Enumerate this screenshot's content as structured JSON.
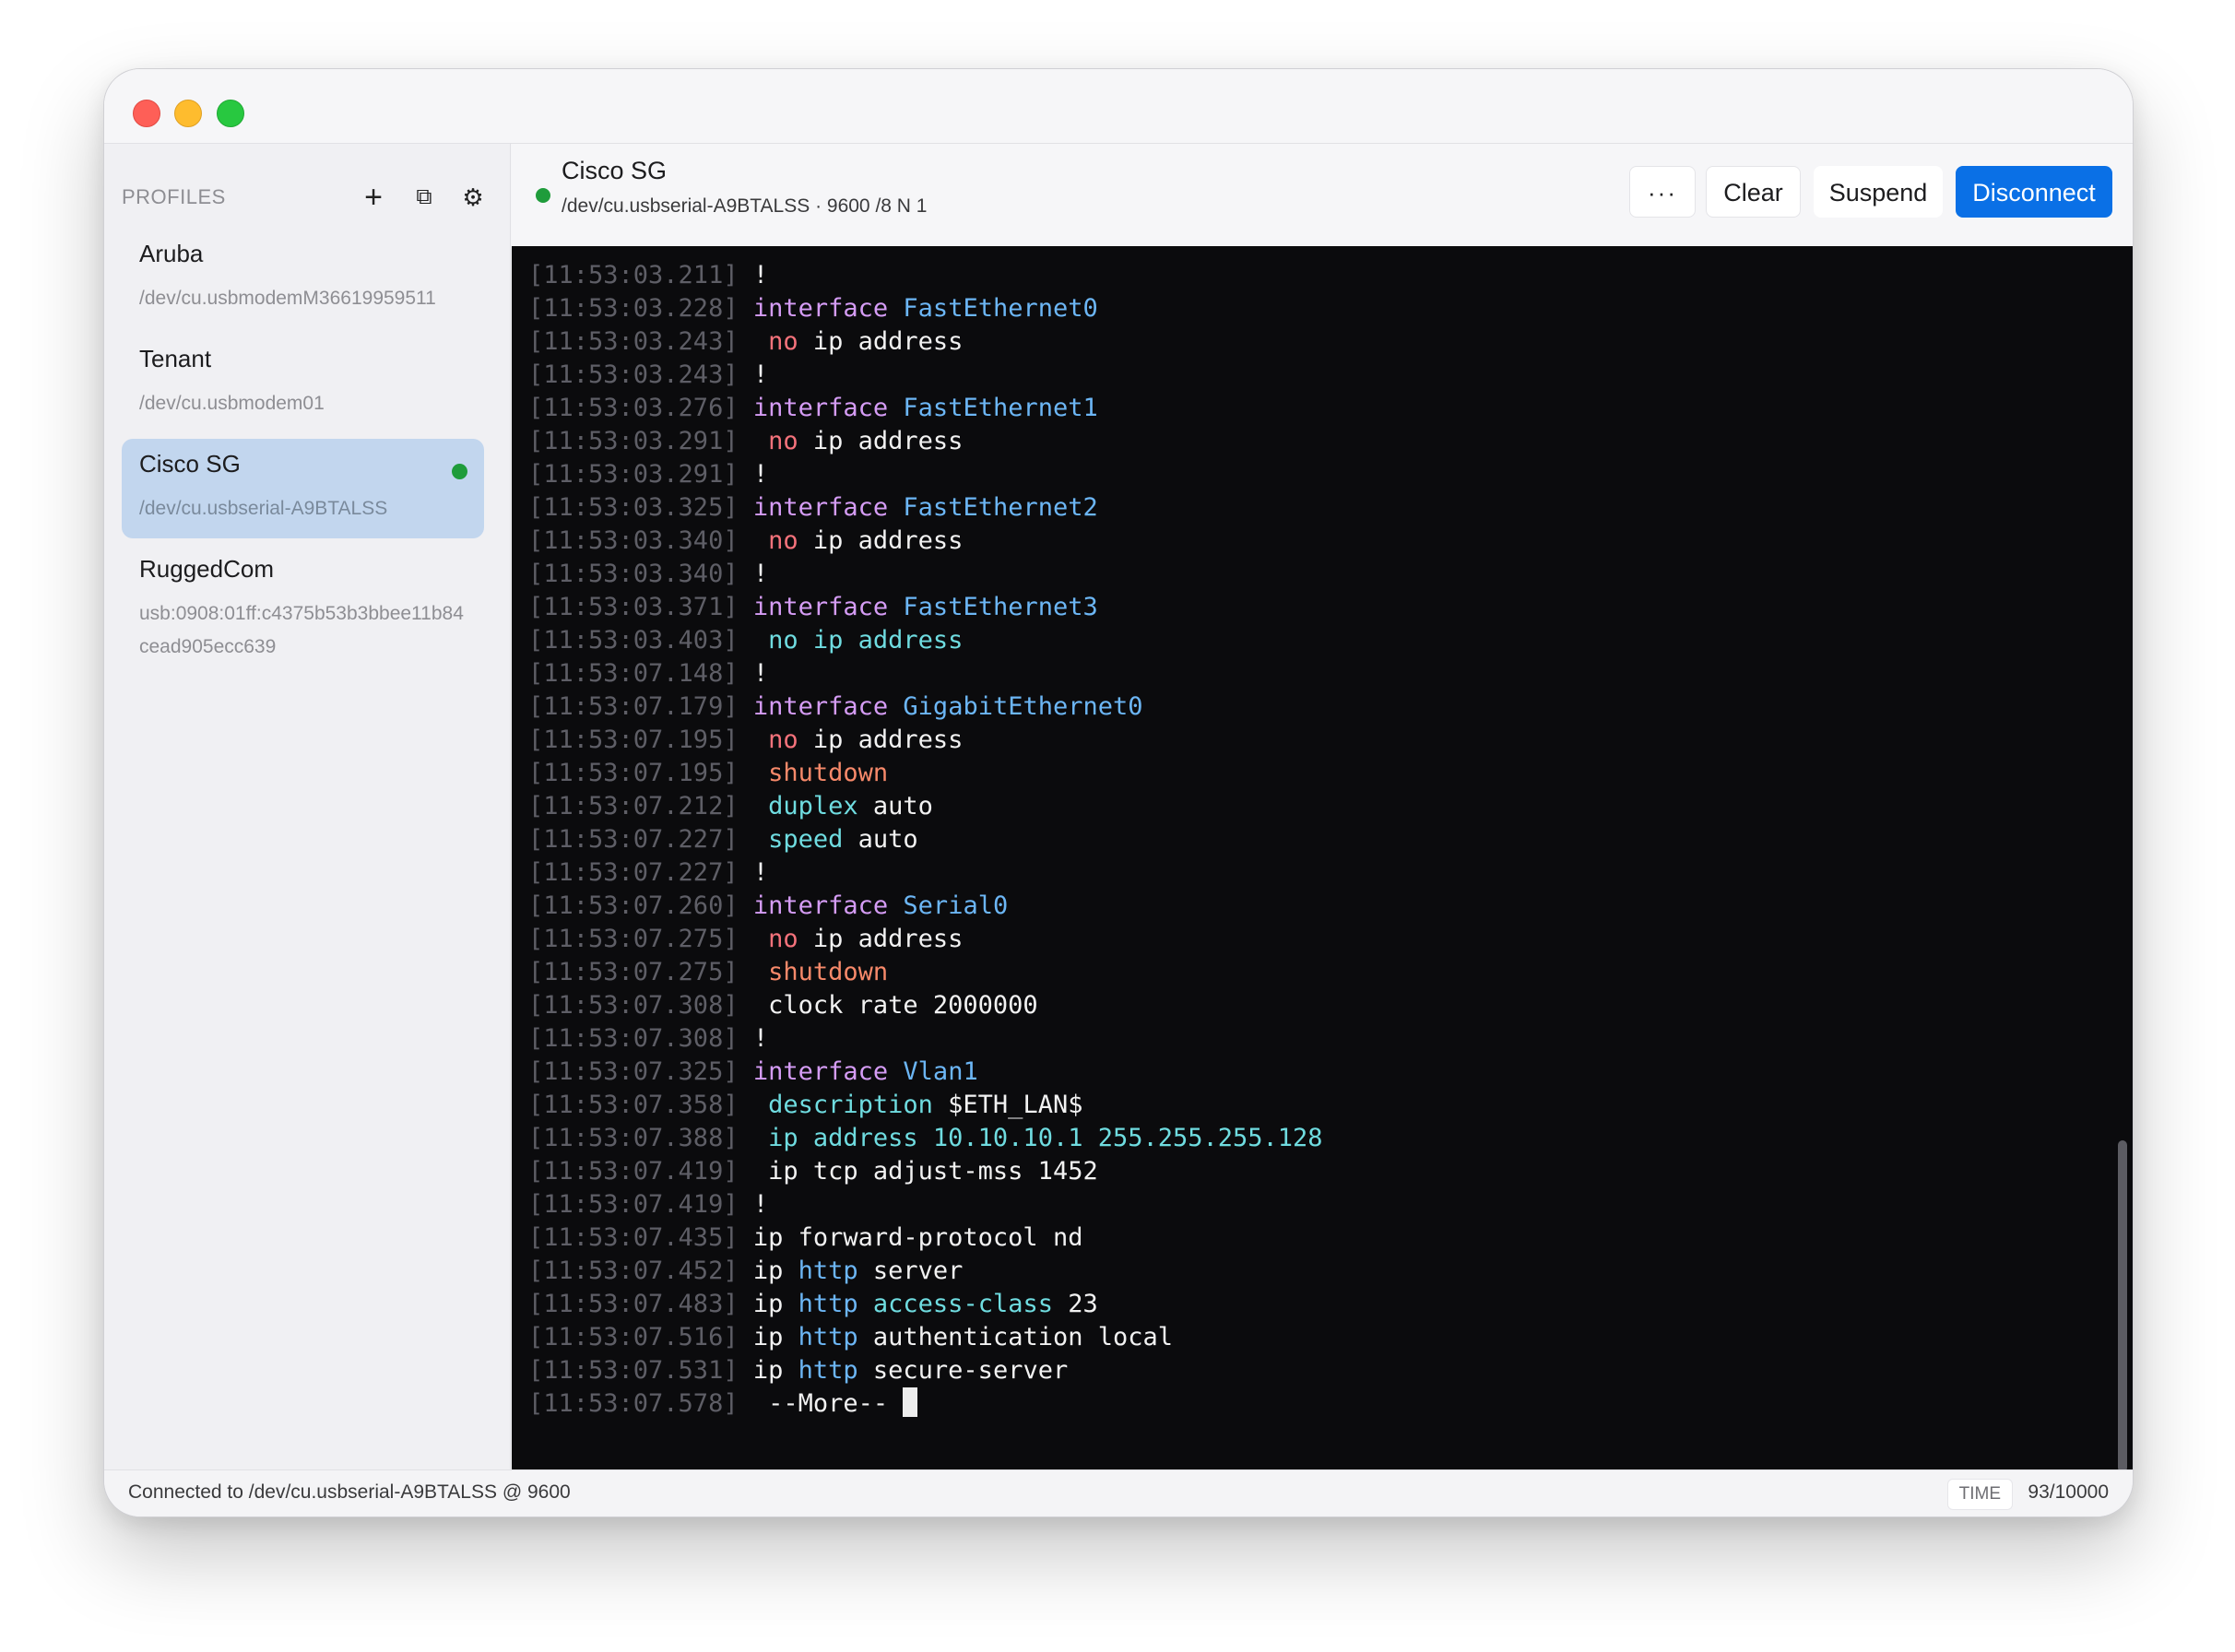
{
  "window": {
    "traffic_lights": [
      "close",
      "minimize",
      "zoom"
    ]
  },
  "sidebar": {
    "title": "PROFILES",
    "actions": {
      "add": "+",
      "duplicate": "⧉",
      "settings": "⚙"
    },
    "profiles": [
      {
        "name": "Aruba",
        "path": "/dev/cu.usbmodemM36619959511",
        "active": false
      },
      {
        "name": "Tenant",
        "path": "/dev/cu.usbmodem01",
        "active": false
      },
      {
        "name": "Cisco SG",
        "path": "/dev/cu.usbserial-A9BTALSS",
        "active": true
      },
      {
        "name": "RuggedCom",
        "path": "usb:0908:01ff:c4375b53b3bbee11b84cead905ecc639",
        "active": false
      }
    ]
  },
  "connection": {
    "title": "Cisco SG",
    "subtitle": "/dev/cu.usbserial-A9BTALSS · 9600 /8 N 1",
    "status_color": "#1f9c3b",
    "buttons": {
      "more": "···",
      "clear": "Clear",
      "suspend": "Suspend",
      "disconnect": "Disconnect"
    }
  },
  "terminal": {
    "lines": [
      {
        "ts": "[11:53:03.211]",
        "segs": [
          [
            "p",
            " !"
          ]
        ]
      },
      {
        "ts": "[11:53:03.228]",
        "segs": [
          [
            "p",
            " "
          ],
          [
            "kw",
            "interface"
          ],
          [
            "p",
            " "
          ],
          [
            "if",
            "FastEthernet0"
          ]
        ]
      },
      {
        "ts": "[11:53:03.243]",
        "segs": [
          [
            "p",
            "  "
          ],
          [
            "neg",
            "no"
          ],
          [
            "p",
            " ip address"
          ]
        ]
      },
      {
        "ts": "[11:53:03.243]",
        "segs": [
          [
            "p",
            " !"
          ]
        ]
      },
      {
        "ts": "[11:53:03.276]",
        "segs": [
          [
            "p",
            " "
          ],
          [
            "kw",
            "interface"
          ],
          [
            "p",
            " "
          ],
          [
            "if",
            "FastEthernet1"
          ]
        ]
      },
      {
        "ts": "[11:53:03.291]",
        "segs": [
          [
            "p",
            "  "
          ],
          [
            "neg",
            "no"
          ],
          [
            "p",
            " ip address"
          ]
        ]
      },
      {
        "ts": "[11:53:03.291]",
        "segs": [
          [
            "p",
            " !"
          ]
        ]
      },
      {
        "ts": "[11:53:03.325]",
        "segs": [
          [
            "p",
            " "
          ],
          [
            "kw",
            "interface"
          ],
          [
            "p",
            " "
          ],
          [
            "if",
            "FastEthernet2"
          ]
        ]
      },
      {
        "ts": "[11:53:03.340]",
        "segs": [
          [
            "p",
            "  "
          ],
          [
            "neg",
            "no"
          ],
          [
            "p",
            " ip address"
          ]
        ]
      },
      {
        "ts": "[11:53:03.340]",
        "segs": [
          [
            "p",
            " !"
          ]
        ]
      },
      {
        "ts": "[11:53:03.371]",
        "segs": [
          [
            "p",
            " "
          ],
          [
            "kw",
            "interface"
          ],
          [
            "p",
            " "
          ],
          [
            "if",
            "FastEthernet3"
          ]
        ]
      },
      {
        "ts": "[11:53:03.403]",
        "segs": [
          [
            "p",
            "  "
          ],
          [
            "cyan",
            "no ip address"
          ]
        ]
      },
      {
        "ts": "[11:53:07.148]",
        "segs": [
          [
            "p",
            " !"
          ]
        ]
      },
      {
        "ts": "[11:53:07.179]",
        "segs": [
          [
            "p",
            " "
          ],
          [
            "kw",
            "interface"
          ],
          [
            "p",
            " "
          ],
          [
            "if",
            "GigabitEthernet0"
          ]
        ]
      },
      {
        "ts": "[11:53:07.195]",
        "segs": [
          [
            "p",
            "  "
          ],
          [
            "neg",
            "no"
          ],
          [
            "p",
            " ip address"
          ]
        ]
      },
      {
        "ts": "[11:53:07.195]",
        "segs": [
          [
            "p",
            "  "
          ],
          [
            "shut",
            "shutdown"
          ]
        ]
      },
      {
        "ts": "[11:53:07.212]",
        "segs": [
          [
            "p",
            "  "
          ],
          [
            "cyan",
            "duplex"
          ],
          [
            "p",
            " auto"
          ]
        ]
      },
      {
        "ts": "[11:53:07.227]",
        "segs": [
          [
            "p",
            "  "
          ],
          [
            "cyan",
            "speed"
          ],
          [
            "p",
            " auto"
          ]
        ]
      },
      {
        "ts": "[11:53:07.227]",
        "segs": [
          [
            "p",
            " !"
          ]
        ]
      },
      {
        "ts": "[11:53:07.260]",
        "segs": [
          [
            "p",
            " "
          ],
          [
            "kw",
            "interface"
          ],
          [
            "p",
            " "
          ],
          [
            "if",
            "Serial0"
          ]
        ]
      },
      {
        "ts": "[11:53:07.275]",
        "segs": [
          [
            "p",
            "  "
          ],
          [
            "neg",
            "no"
          ],
          [
            "p",
            " ip address"
          ]
        ]
      },
      {
        "ts": "[11:53:07.275]",
        "segs": [
          [
            "p",
            "  "
          ],
          [
            "shut",
            "shutdown"
          ]
        ]
      },
      {
        "ts": "[11:53:07.308]",
        "segs": [
          [
            "p",
            "  clock rate 2000000"
          ]
        ]
      },
      {
        "ts": "[11:53:07.308]",
        "segs": [
          [
            "p",
            " !"
          ]
        ]
      },
      {
        "ts": "[11:53:07.325]",
        "segs": [
          [
            "p",
            " "
          ],
          [
            "kw",
            "interface"
          ],
          [
            "p",
            " "
          ],
          [
            "if",
            "Vlan1"
          ]
        ]
      },
      {
        "ts": "[11:53:07.358]",
        "segs": [
          [
            "p",
            "  "
          ],
          [
            "cyan",
            "description"
          ],
          [
            "p",
            " $ETH_LAN$"
          ]
        ]
      },
      {
        "ts": "[11:53:07.388]",
        "segs": [
          [
            "p",
            "  "
          ],
          [
            "cyan",
            "ip address 10.10.10.1 255.255.255.128"
          ]
        ]
      },
      {
        "ts": "[11:53:07.419]",
        "segs": [
          [
            "p",
            "  ip tcp adjust-mss 1452"
          ]
        ]
      },
      {
        "ts": "[11:53:07.419]",
        "segs": [
          [
            "p",
            " !"
          ]
        ]
      },
      {
        "ts": "[11:53:07.435]",
        "segs": [
          [
            "p",
            " ip forward-protocol nd"
          ]
        ]
      },
      {
        "ts": "[11:53:07.452]",
        "segs": [
          [
            "p",
            " ip "
          ],
          [
            "if",
            "http"
          ],
          [
            "p",
            " server"
          ]
        ]
      },
      {
        "ts": "[11:53:07.483]",
        "segs": [
          [
            "p",
            " ip "
          ],
          [
            "if",
            "http"
          ],
          [
            "p",
            " "
          ],
          [
            "cyan",
            "access-class"
          ],
          [
            "p",
            " 23"
          ]
        ]
      },
      {
        "ts": "[11:53:07.516]",
        "segs": [
          [
            "p",
            " ip "
          ],
          [
            "if",
            "http"
          ],
          [
            "p",
            " authentication local"
          ]
        ]
      },
      {
        "ts": "[11:53:07.531]",
        "segs": [
          [
            "p",
            " ip "
          ],
          [
            "if",
            "http"
          ],
          [
            "p",
            " secure-server"
          ]
        ]
      },
      {
        "ts": "[11:53:07.578]",
        "segs": [
          [
            "p",
            "  --More-- "
          ]
        ],
        "cursor": true
      }
    ]
  },
  "statusbar": {
    "text": "Connected to /dev/cu.usbserial-A9BTALSS @ 9600",
    "time_badge": "TIME",
    "line_count": "93/10000"
  },
  "colors": {
    "accent": "#0a70e6",
    "connected": "#1f9c3b",
    "selected_profile": "#c2d6ee",
    "terminal_bg": "#0b0b0d"
  }
}
